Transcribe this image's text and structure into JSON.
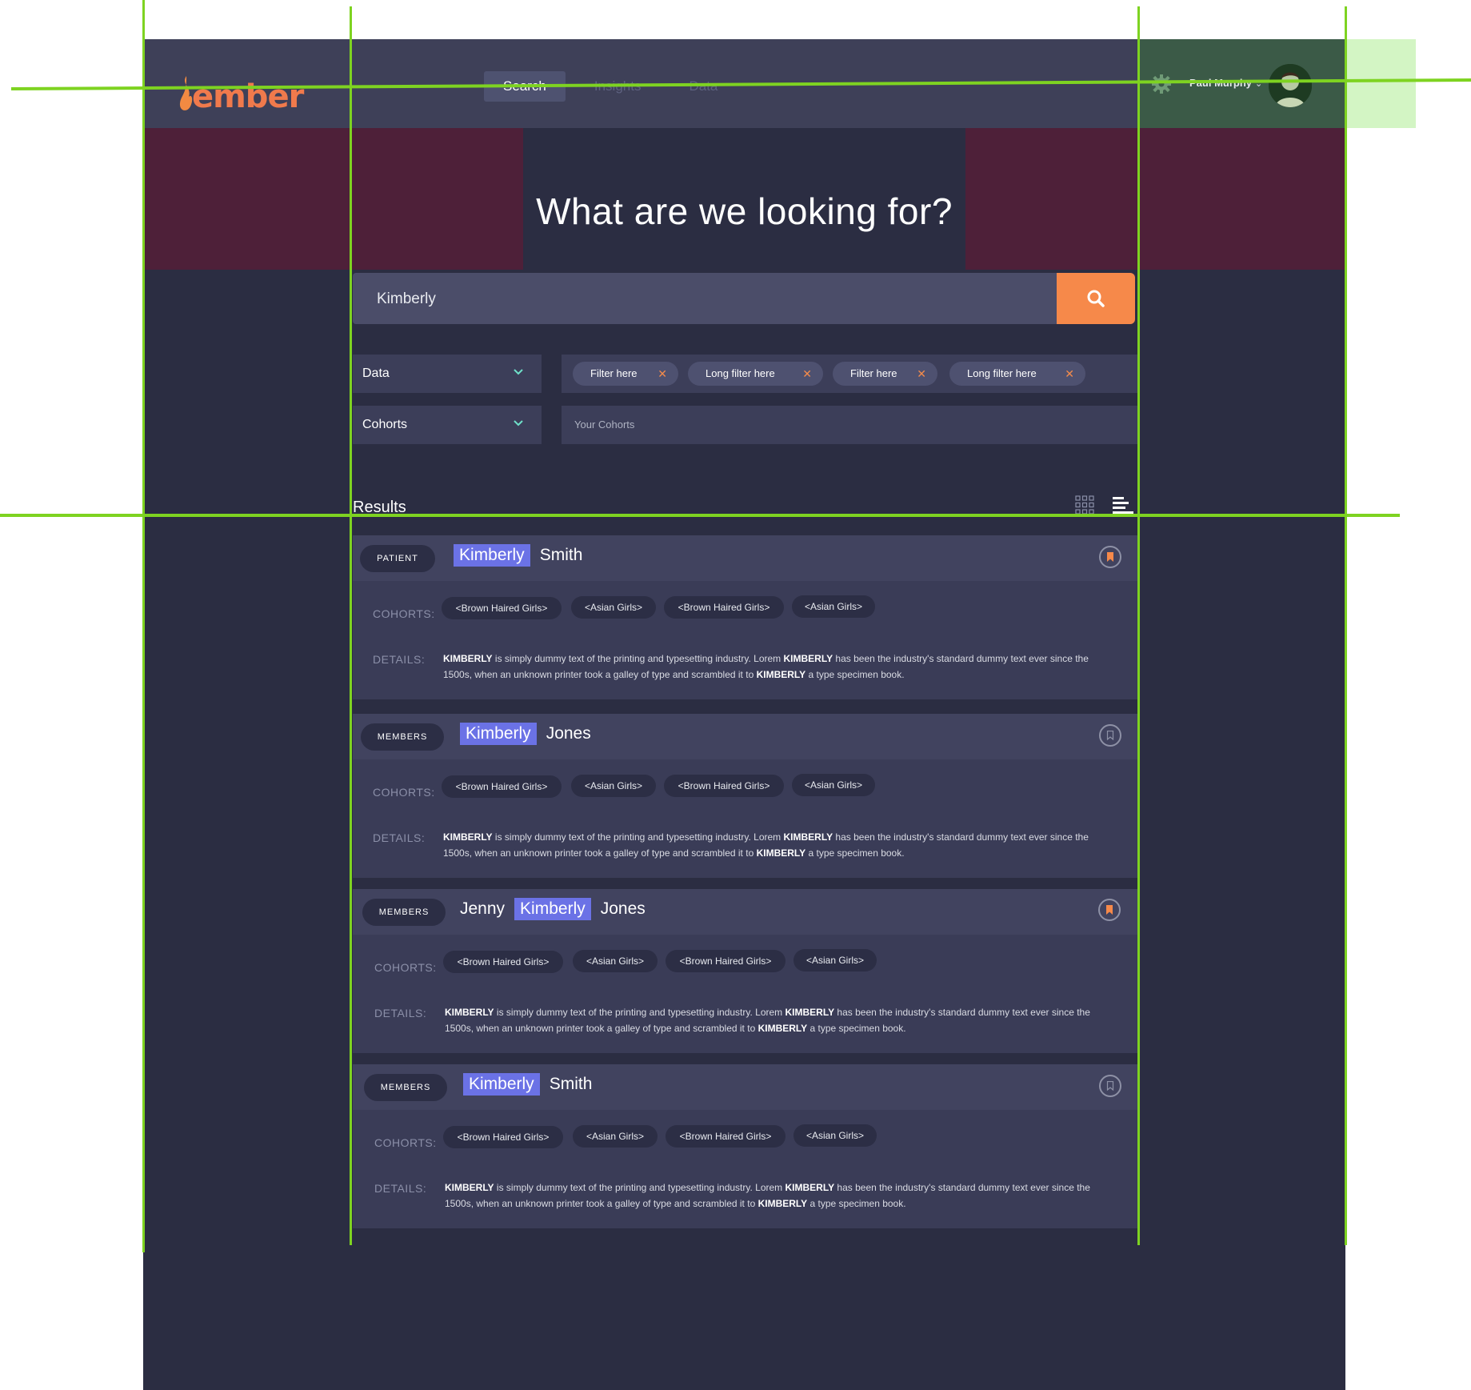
{
  "brand": {
    "name": "ember"
  },
  "nav": {
    "items": [
      {
        "label": "Search",
        "active": true
      },
      {
        "label": "Insights"
      },
      {
        "label": "Data"
      }
    ]
  },
  "user": {
    "name": "Paul Murphy"
  },
  "hero": {
    "title": "What are we looking for?"
  },
  "search": {
    "value": "Kimberly"
  },
  "dropdowns": {
    "data_label": "Data",
    "cohorts_label": "Cohorts"
  },
  "filters": [
    "Filter here",
    "Long filter here",
    "Filter here",
    "Long filter here"
  ],
  "cohorts_field": {
    "placeholder": "Your Cohorts"
  },
  "results": {
    "title": "Results",
    "cohorts_label": "COHORTS:",
    "details_label": "DETAILS:",
    "items": [
      {
        "type": "PATIENT",
        "first": "",
        "highlight": "Kimberly",
        "last": "Smith",
        "bookmarked": true,
        "cohorts": [
          "<Brown Haired Girls>",
          "<Asian Girls>",
          "<Brown Haired Girls>",
          "<Asian Girls>"
        ],
        "details": {
          "k": "KIMBERLY",
          "t1": " is simply dummy text of the printing and typesetting industry. Lorem ",
          "t2": " has been the industry's standard dummy text ever since the 1500s, when an unknown printer took a galley of type and scrambled it to ",
          "t3": " a type specimen book."
        }
      },
      {
        "type": "MEMBERS",
        "first": "",
        "highlight": "Kimberly",
        "last": "Jones",
        "bookmarked": false,
        "cohorts": [
          "<Brown Haired Girls>",
          "<Asian Girls>",
          "<Brown Haired Girls>",
          "<Asian Girls>"
        ],
        "details": {
          "k": "KIMBERLY",
          "t1": " is simply dummy text of the printing and typesetting industry. Lorem ",
          "t2": " has been the industry's standard dummy text ever since the 1500s, when an unknown printer took a galley of type and scrambled it to ",
          "t3": " a type specimen book."
        }
      },
      {
        "type": "MEMBERS",
        "first": "Jenny",
        "highlight": "Kimberly",
        "last": "Jones",
        "bookmarked": true,
        "cohorts": [
          "<Brown Haired Girls>",
          "<Asian Girls>",
          "<Brown Haired Girls>",
          "<Asian Girls>"
        ],
        "details": {
          "k": "KIMBERLY",
          "t1": " is simply dummy text of the printing and typesetting industry. Lorem ",
          "t2": " has been the industry's standard dummy text ever since the 1500s, when an unknown printer took a galley of type and scrambled it to ",
          "t3": " a type specimen book."
        }
      },
      {
        "type": "MEMBERS",
        "first": "",
        "highlight": "Kimberly",
        "last": "Smith",
        "bookmarked": false,
        "cohorts": [
          "<Brown Haired Girls>",
          "<Asian Girls>",
          "<Brown Haired Girls>",
          "<Asian Girls>"
        ],
        "details": {
          "k": "KIMBERLY",
          "t1": " is simply dummy text of the printing and typesetting industry. Lorem ",
          "t2": " has been the industry's standard dummy text ever since the 1500s, when an unknown printer took a galley of type and scrambled it to ",
          "t3": " a type specimen book."
        }
      }
    ]
  },
  "colors": {
    "accent": "#f6894a",
    "highlight": "#6b72e6",
    "background": "#2b2d42",
    "guide": "#7ed321"
  }
}
